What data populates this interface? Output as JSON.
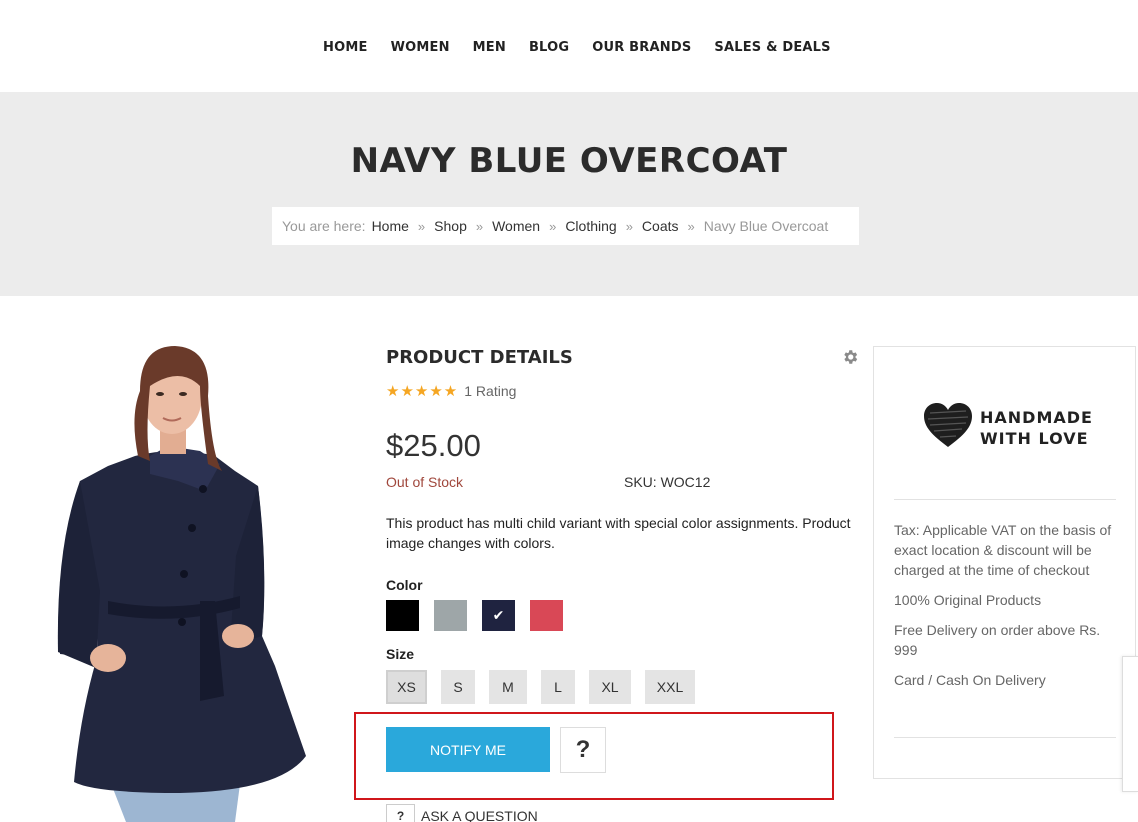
{
  "nav": {
    "items": [
      "HOME",
      "WOMEN",
      "MEN",
      "BLOG",
      "OUR BRANDS",
      "SALES & DEALS"
    ]
  },
  "banner": {
    "title": "NAVY BLUE OVERCOAT",
    "breadcrumb_prefix": "You are here:",
    "breadcrumb": [
      "Home",
      "Shop",
      "Women",
      "Clothing",
      "Coats"
    ],
    "current": "Navy Blue Overcoat"
  },
  "product": {
    "section_title": "PRODUCT DETAILS",
    "rating_stars": 5,
    "rating_text": "1 Rating",
    "price": "$25.00",
    "stock_status": "Out of Stock",
    "sku": "SKU: WOC12",
    "description": "This product has multi child variant with special color assignments. Product image changes with colors.",
    "color_label": "Color",
    "colors": [
      "#000000",
      "#9ea6a8",
      "#1f2340",
      "#d94856"
    ],
    "selected_color_index": 2,
    "size_label": "Size",
    "sizes": [
      "XS",
      "S",
      "M",
      "L",
      "XL",
      "XXL"
    ],
    "selected_size_index": 0,
    "notify_label": "NOTIFY ME",
    "question_symbol": "?",
    "ask_label": "ASK A QUESTION"
  },
  "sidebar": {
    "logo_line1": "HANDMADE",
    "logo_line2": "WITH LOVE",
    "info": [
      "Tax: Applicable VAT on the basis of exact location & discount will be charged at the time of checkout",
      "100% Original Products",
      "Free Delivery on order above Rs. 999",
      "Card / Cash On Delivery"
    ]
  },
  "colors": {
    "accent": "#2aa8db",
    "out_of_stock": "#a0473c",
    "star": "#f5a623",
    "highlight": "#d0161b"
  }
}
